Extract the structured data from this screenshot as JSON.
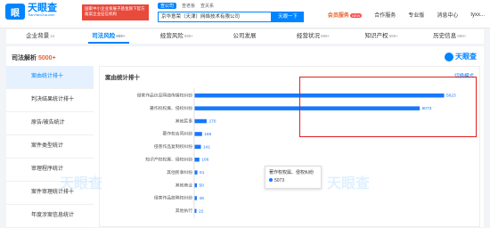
{
  "app": {
    "logo_cn": "天眼查",
    "logo_en": "TianYanCha.com",
    "promo_text": "国家中小企业发展子基金旗下官方备案企业征信机构"
  },
  "search": {
    "scope_tabs": [
      "查公司",
      "查老板",
      "查关系"
    ],
    "value": "京华意荣（天津）网络技术有限公司",
    "button_label": "天眼一下"
  },
  "nav_right": {
    "vip": "会员服务",
    "vip_badge": "NEW",
    "items": [
      "合作服务",
      "专业版",
      "消息中心",
      "tyxx..."
    ]
  },
  "category_tabs": [
    {
      "label": "企业背景",
      "count": "44"
    },
    {
      "label": "司法风险",
      "count": "999+"
    },
    {
      "label": "经营风险",
      "count": "999+"
    },
    {
      "label": "公司发展",
      "count": ""
    },
    {
      "label": "经营状况",
      "count": "999+"
    },
    {
      "label": "知识产权",
      "count": "999+"
    },
    {
      "label": "历史信息",
      "count": "999+"
    }
  ],
  "panel": {
    "title": "司法解析",
    "count": "5000+",
    "watermark": "天眼查"
  },
  "left_nav": [
    "案由统计排十",
    "判决结果统计排十",
    "原告/被告统计",
    "案件类型统计",
    "审理程序统计",
    "案件审理统计排十",
    "年度涉案信息统计"
  ],
  "chart": {
    "title": "案由统计排十",
    "link": "切换模式"
  },
  "chart_data": {
    "type": "bar",
    "orientation": "horizontal",
    "categories": [
      "侵害作品信息网络传播权纠纷",
      "著作权权属、侵权纠纷",
      "其他民事",
      "著作权合同纠纷",
      "侵害作品复制权纠纷",
      "知识产权权属、侵权纠纷",
      "其他民事纠纷",
      "其他商业",
      "侵害作品放映权纠纷",
      "其他执行"
    ],
    "values": [
      5623,
      5073,
      270,
      166,
      141,
      106,
      61,
      50,
      49,
      22
    ],
    "color": "#1677ff"
  },
  "tooltip": {
    "label": "著作权权属、侵权纠纷",
    "value": "5073"
  }
}
